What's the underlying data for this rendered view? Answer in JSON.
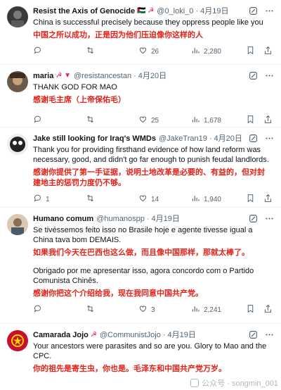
{
  "tweets": [
    {
      "name": "Resist the Axis of Genocide",
      "badges": "🇵🇸 ☭",
      "handle": "@0_loki_0",
      "time": "4月19日",
      "text_en": "China is successful precisely because they oppress people like you",
      "text_zh": "中国之所以成功，正是因为他们压迫像你这样的人",
      "text_en2": "",
      "text_zh2": "",
      "replies": "",
      "retweets": "",
      "likes": "26",
      "views": "2,280"
    },
    {
      "name": "maria",
      "badges": "☭ ▼",
      "handle": "@resistancestan",
      "time": "4月20日",
      "text_en": "THANK GOD FOR MAO",
      "text_zh": "感谢毛主席（上帝保佑毛）",
      "text_en2": "",
      "text_zh2": "",
      "replies": "",
      "retweets": "",
      "likes": "25",
      "views": "1,678"
    },
    {
      "name": "Jake still looking for Iraq's WMDs",
      "badges": "",
      "handle": "@JakeTran19",
      "time": "4月20日",
      "text_en": "Thank you for providing firsthand evidence of how land reform was necessary, good, and didn't go far enough to punish feudal landlords.",
      "text_zh": "感谢你提供了第一手证据，说明土地改革是必要的、有益的，但对封建地主的惩罚力度仍不够。",
      "text_en2": "",
      "text_zh2": "",
      "replies": "1",
      "retweets": "",
      "likes": "14",
      "views": "1,940"
    },
    {
      "name": "Humano comum",
      "badges": "",
      "handle": "@humanospp",
      "time": "4月19日",
      "text_en": "Se tivéssemos feito isso no Brasile hoje e agente tivesse igual a China tava bom DEMAIS.",
      "text_zh": "如果我们今天在巴西也这么做，而且像中国那样，那就太棒了。",
      "text_en2": "Obrigado por me apresentar isso, agora concordo com o Partido Comunista Chinês.",
      "text_zh2": "感谢你把这个介绍给我，现在我同意中国共产党。",
      "replies": "",
      "retweets": "",
      "likes": "3",
      "views": "2,241"
    },
    {
      "name": "Camarada Jojo",
      "badges": "☭",
      "handle": "@CommunistJojo",
      "time": "4月19日",
      "text_en": "Your ancestors were parasites and so are you. Glory to Mao and the CPC.",
      "text_zh": "你的祖先是寄生虫，你也是。毛泽东和中国共产党万岁。",
      "text_en2": "",
      "text_zh2": "",
      "replies": "",
      "retweets": "",
      "likes": "",
      "views": ""
    }
  ],
  "watermark": "公众号 · songmin_001",
  "colors": {
    "accent_red": "#e2231a",
    "secondary_text": "#536471",
    "divider": "#eff3f4"
  },
  "icons": [
    "grok-icon",
    "more-icon",
    "reply-icon",
    "retweet-icon",
    "like-icon",
    "views-icon",
    "bookmark-icon",
    "share-icon"
  ]
}
